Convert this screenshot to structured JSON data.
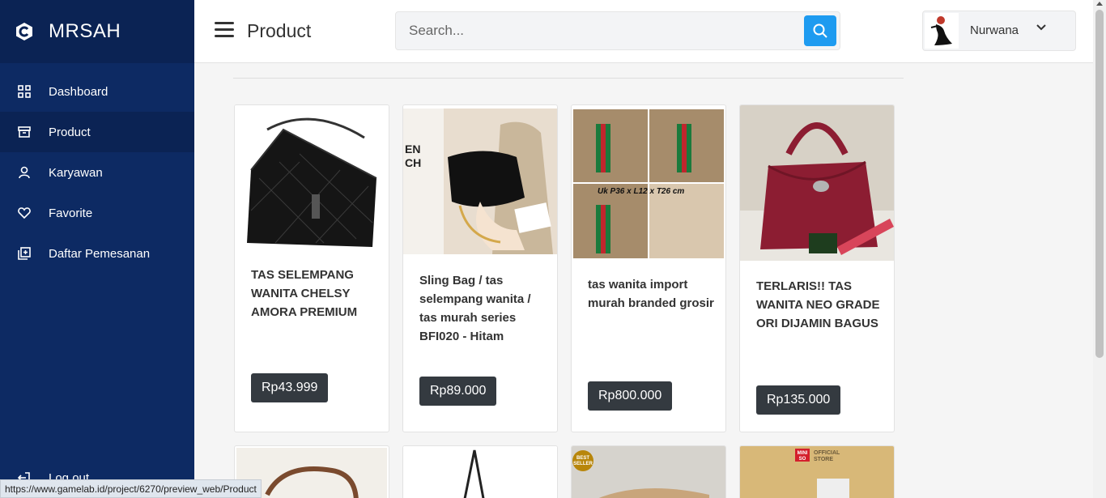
{
  "brand": {
    "name": "MRSAH"
  },
  "sidebar": {
    "items": [
      {
        "label": "Dashboard",
        "icon": "grid-icon"
      },
      {
        "label": "Product",
        "icon": "archive-icon"
      },
      {
        "label": "Karyawan",
        "icon": "user-icon"
      },
      {
        "label": "Favorite",
        "icon": "heart-icon"
      },
      {
        "label": "Daftar Pemesanan",
        "icon": "add-list-icon"
      }
    ],
    "logout_label": "Log out"
  },
  "header": {
    "title": "Product",
    "search_placeholder": "Search...",
    "user_name": "Nurwana"
  },
  "products": [
    {
      "title": "TAS SELEMPANG WANITA CHELSY AMORA PREMIUM",
      "price": "Rp43.999"
    },
    {
      "title": "Sling Bag / tas selempang wanita / tas murah series BFI020 - Hitam",
      "price": "Rp89.000"
    },
    {
      "title": "tas wanita import murah branded grosir",
      "price": "Rp800.000"
    },
    {
      "title": "TERLARIS!! TAS WANITA NEO GRADE ORI DIJAMIN BAGUS",
      "price": "Rp135.000"
    }
  ],
  "image_texts": {
    "p2_sign": "EN\nCH",
    "p3_caption": "Uk P36 x L12 x T26 cm",
    "row2_badge": "BEST SELLER",
    "row2_store_logo": "MINI SO",
    "row2_store": "OFFICIAL STORE"
  },
  "status_url": "https://www.gamelab.id/project/6270/preview_web/Product",
  "colors": {
    "sidebar": "#0d2a63",
    "accent": "#1e9bf0",
    "price_button": "#343a40"
  }
}
